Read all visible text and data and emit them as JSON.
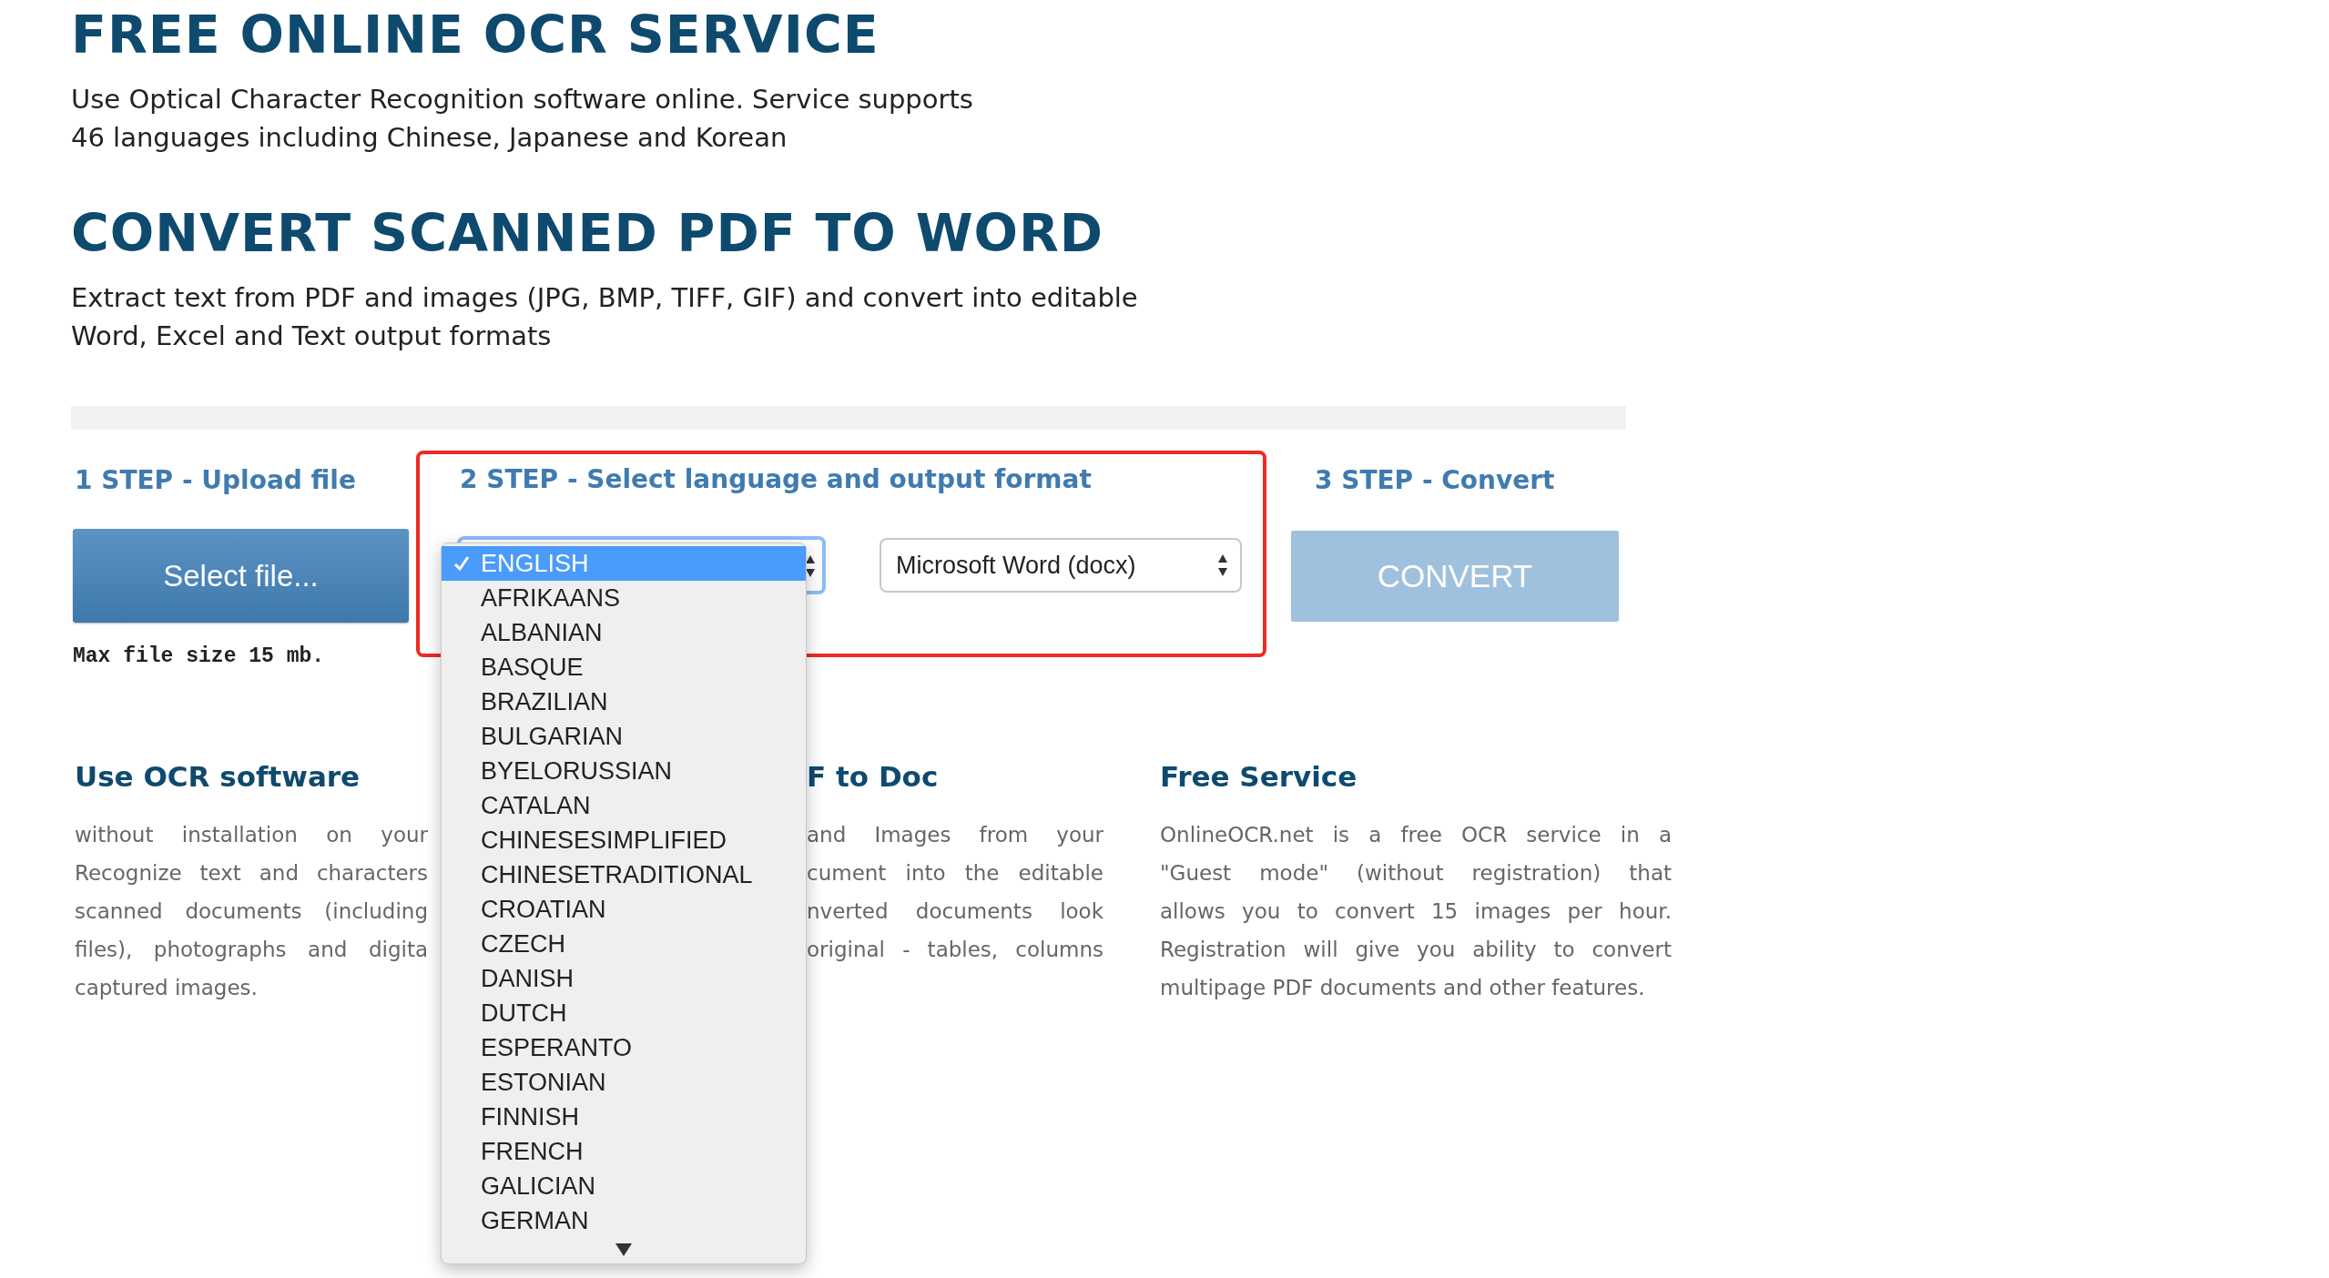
{
  "intro": {
    "title": "FREE ONLINE OCR SERVICE",
    "lines": [
      "Use Optical Character Recognition software online. Service supports",
      "46 languages including Chinese, Japanese and Korean"
    ]
  },
  "converter": {
    "title": "CONVERT SCANNED PDF TO WORD",
    "lines": [
      "Extract text from PDF and images (JPG, BMP, TIFF, GIF) and convert into editable",
      "Word, Excel and Text output formats"
    ]
  },
  "steps": [
    {
      "kind": "upload",
      "label": "1 STEP - Upload file",
      "button": "Select file...",
      "note": "Max file size 15 mb."
    },
    {
      "kind": "options",
      "label": "2 STEP - Select language and output format",
      "highlighted": true,
      "language_select": {
        "expanded": true,
        "options": [
          {
            "label": "ENGLISH",
            "selected": true
          },
          {
            "label": "AFRIKAANS",
            "selected": false
          },
          {
            "label": "ALBANIAN",
            "selected": false
          },
          {
            "label": "BASQUE",
            "selected": false
          },
          {
            "label": "BRAZILIAN",
            "selected": false
          },
          {
            "label": "BULGARIAN",
            "selected": false
          },
          {
            "label": "BYELORUSSIAN",
            "selected": false
          },
          {
            "label": "CATALAN",
            "selected": false
          },
          {
            "label": "CHINESESIMPLIFIED",
            "selected": false
          },
          {
            "label": "CHINESETRADITIONAL",
            "selected": false
          },
          {
            "label": "CROATIAN",
            "selected": false
          },
          {
            "label": "CZECH",
            "selected": false
          },
          {
            "label": "DANISH",
            "selected": false
          },
          {
            "label": "DUTCH",
            "selected": false
          },
          {
            "label": "ESPERANTO",
            "selected": false
          },
          {
            "label": "ESTONIAN",
            "selected": false
          },
          {
            "label": "FINNISH",
            "selected": false
          },
          {
            "label": "FRENCH",
            "selected": false
          },
          {
            "label": "GALICIAN",
            "selected": false
          },
          {
            "label": "GERMAN",
            "selected": false
          }
        ]
      },
      "format_select": {
        "value": "Microsoft Word (docx)"
      }
    },
    {
      "kind": "convert",
      "label": "3 STEP - Convert",
      "button": "CONVERT",
      "disabled": true
    }
  ],
  "features": [
    {
      "title": "Use OCR software",
      "complete": true,
      "lines": [
        "without installation on your",
        "Recognize text and characters",
        "scanned documents (including",
        "files), photographs and digita",
        "captured images."
      ]
    },
    {
      "title": "F to Doc",
      "complete": false,
      "lines": [
        "and Images from your",
        "cument into the editable",
        "nverted documents look",
        "original - tables, columns"
      ]
    },
    {
      "title": "Free Service",
      "complete": true,
      "lines": [
        "OnlineOCR.net is a free OCR service in a",
        "\"Guest mode\" (without registration) that",
        "allows you to convert 15 images per hour.",
        "Registration will give you ability to convert",
        "multipage PDF documents and other features."
      ]
    }
  ]
}
